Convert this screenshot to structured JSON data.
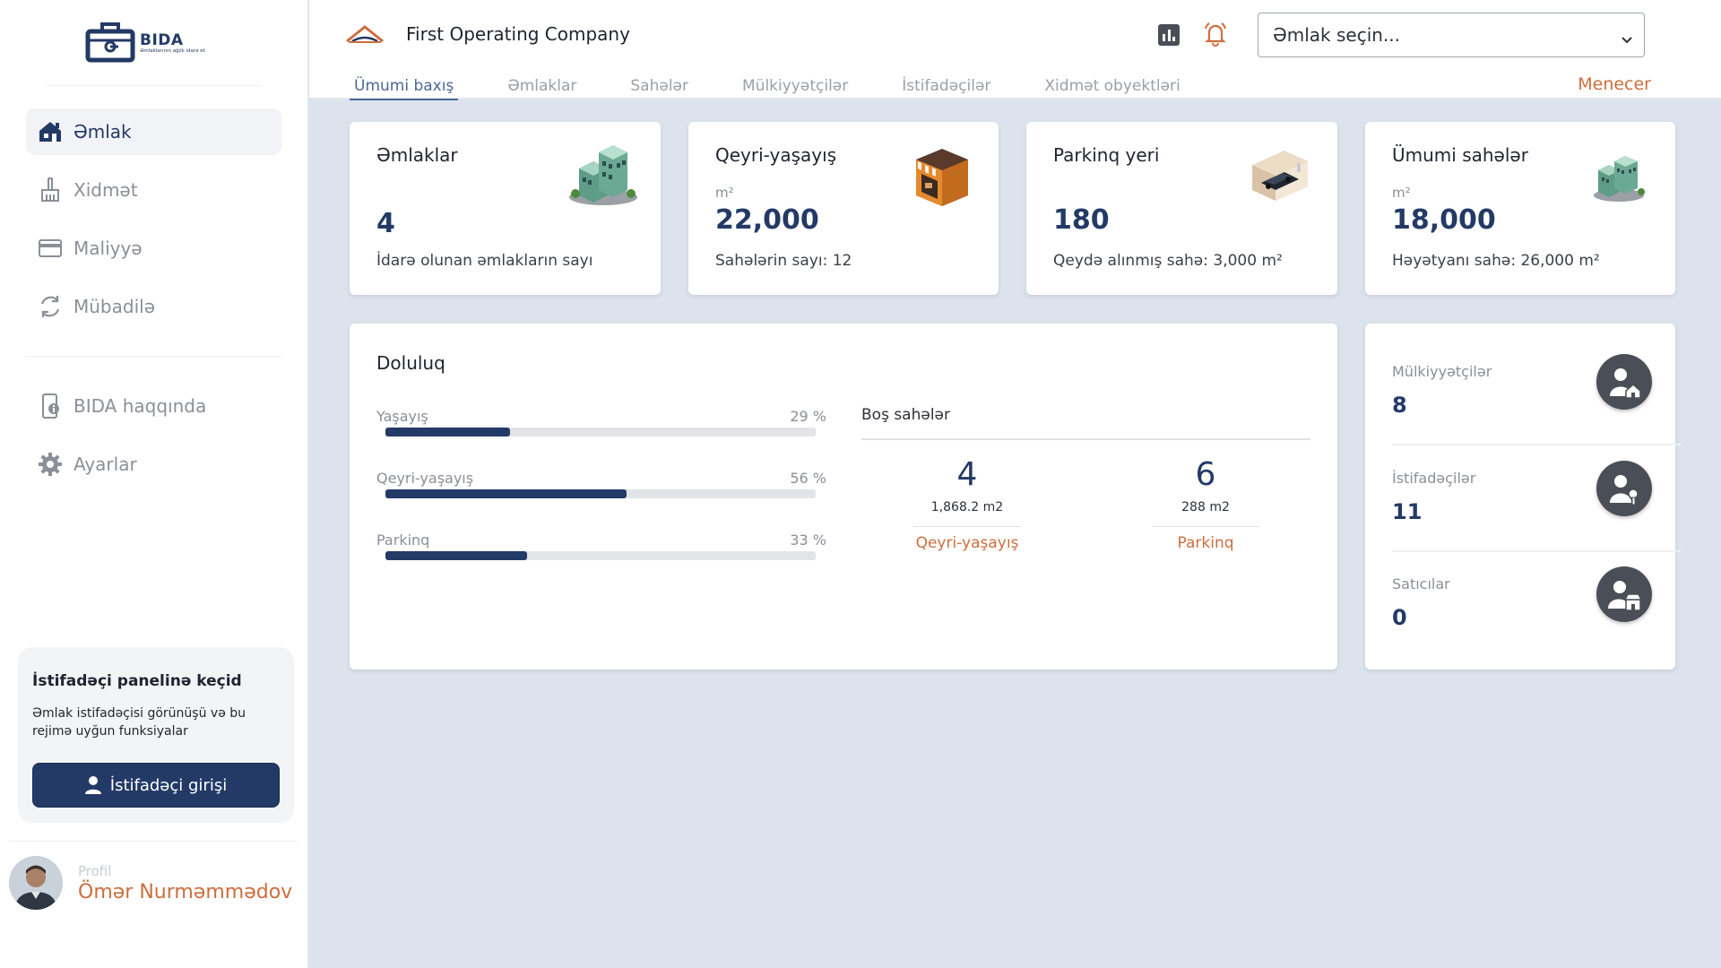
{
  "brand": {
    "name": "BIDA",
    "tagline": "Əmlaklarının ağıllı idarə et"
  },
  "sidebar": {
    "items": [
      {
        "label": "Əmlak",
        "icon": "home-icon",
        "active": true
      },
      {
        "label": "Xidmət",
        "icon": "broom-icon",
        "active": false
      },
      {
        "label": "Maliyyə",
        "icon": "card-icon",
        "active": false
      },
      {
        "label": "Mübadilə",
        "icon": "sync-icon",
        "active": false
      }
    ],
    "secondary_items": [
      {
        "label": "BIDA haqqında",
        "icon": "device-info-icon"
      },
      {
        "label": "Ayarlar",
        "icon": "gear-icon"
      }
    ],
    "switch_panel": {
      "title": "İstifadəçi panelinə keçid",
      "description": "Əmlak istifadəçisi görünüşü və bu rejimə uyğun funksiyalar",
      "button_label": "İstifadəçi girişi"
    },
    "profile": {
      "label": "Profil",
      "name": "Ömər Nurməmmədov"
    }
  },
  "header": {
    "company": "First Operating Company",
    "select_placeholder": "Əmlak seçin...",
    "tabs": [
      "Ümumi baxış",
      "Əmlaklar",
      "Sahələr",
      "Mülkiyyətçilər",
      "İstifadəçilər",
      "Xidmət obyektləri"
    ],
    "active_tab": "Ümumi baxış",
    "role": "Menecer"
  },
  "stats": [
    {
      "title": "Əmlaklar",
      "unit": "",
      "value": "4",
      "desc": "İdarə olunan əmlakların sayı",
      "icon": "buildings-icon"
    },
    {
      "title": "Qeyri-yaşayış",
      "unit": "m²",
      "value": "22,000",
      "desc": "Sahələrin sayı: 12",
      "icon": "shop-icon"
    },
    {
      "title": "Parkinq yeri",
      "unit": "",
      "value": "180",
      "desc": "Qeydə alınmış sahə: 3,000 m²",
      "icon": "parking-car-icon"
    },
    {
      "title": "Ümumi sahələr",
      "unit": "m²",
      "value": "18,000",
      "desc": "Həyətyanı sahə: 26,000 m²",
      "icon": "apartment-blocks-icon"
    }
  ],
  "occupancy": {
    "title": "Doluluq",
    "bars": [
      {
        "label": "Yaşayış",
        "pct_text": "29 %",
        "value": 0.29
      },
      {
        "label": "Qeyri-yaşayış",
        "pct_text": "56 %",
        "value": 0.56
      },
      {
        "label": "Parkinq",
        "pct_text": "33 %",
        "value": 0.33
      }
    ],
    "vacant": {
      "title": "Boş sahələr",
      "items": [
        {
          "count": "4",
          "area": "1,868.2 m2",
          "label": "Qeyri-yaşayış"
        },
        {
          "count": "6",
          "area": "288 m2",
          "label": "Parkinq"
        }
      ]
    }
  },
  "people": [
    {
      "label": "Mülkiyyətçilər",
      "value": "8",
      "icon": "owner-house-icon"
    },
    {
      "label": "İstifadəçilər",
      "value": "11",
      "icon": "user-key-icon"
    },
    {
      "label": "Satıcılar",
      "value": "0",
      "icon": "seller-shop-icon"
    }
  ],
  "colors": {
    "primary": "#233a66",
    "accent": "#cc6e3d",
    "background": "#dde3ec"
  }
}
